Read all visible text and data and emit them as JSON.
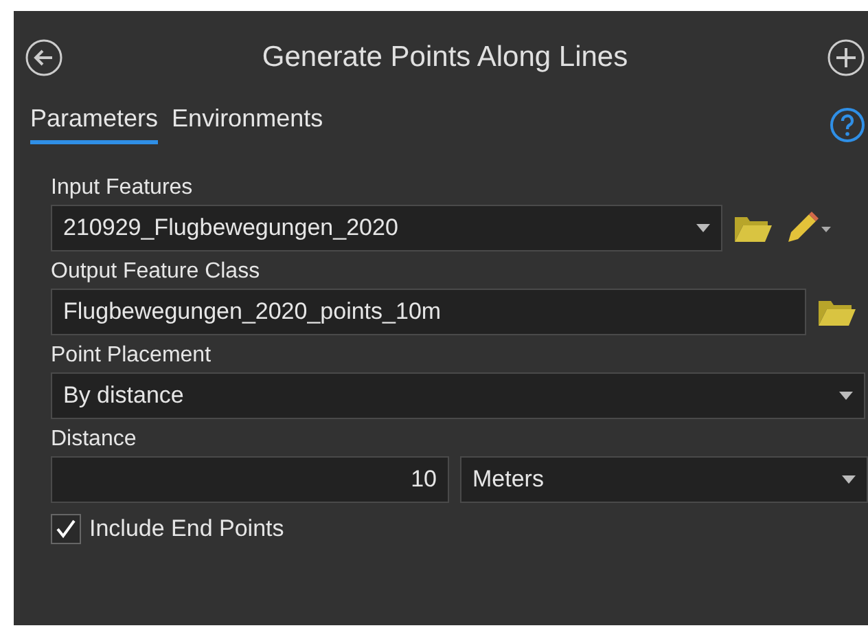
{
  "title": "Generate Points Along Lines",
  "tabs": [
    {
      "label": "Parameters",
      "selected": true
    },
    {
      "label": "Environments",
      "selected": false
    }
  ],
  "parameters": [
    {
      "kind": "layer",
      "label": "Input Features",
      "value": "210929_Flugbewegungen_2020"
    },
    {
      "kind": "output",
      "label": "Output Feature Class",
      "value": "Flugbewegungen_2020_points_10m"
    },
    {
      "kind": "dropdown",
      "label": "Point Placement",
      "value": "By distance"
    },
    {
      "kind": "linear_unit",
      "label": "Distance",
      "value": "10",
      "unit": "Meters"
    },
    {
      "kind": "checkbox",
      "label": "Include End Points",
      "checked": true
    }
  ]
}
